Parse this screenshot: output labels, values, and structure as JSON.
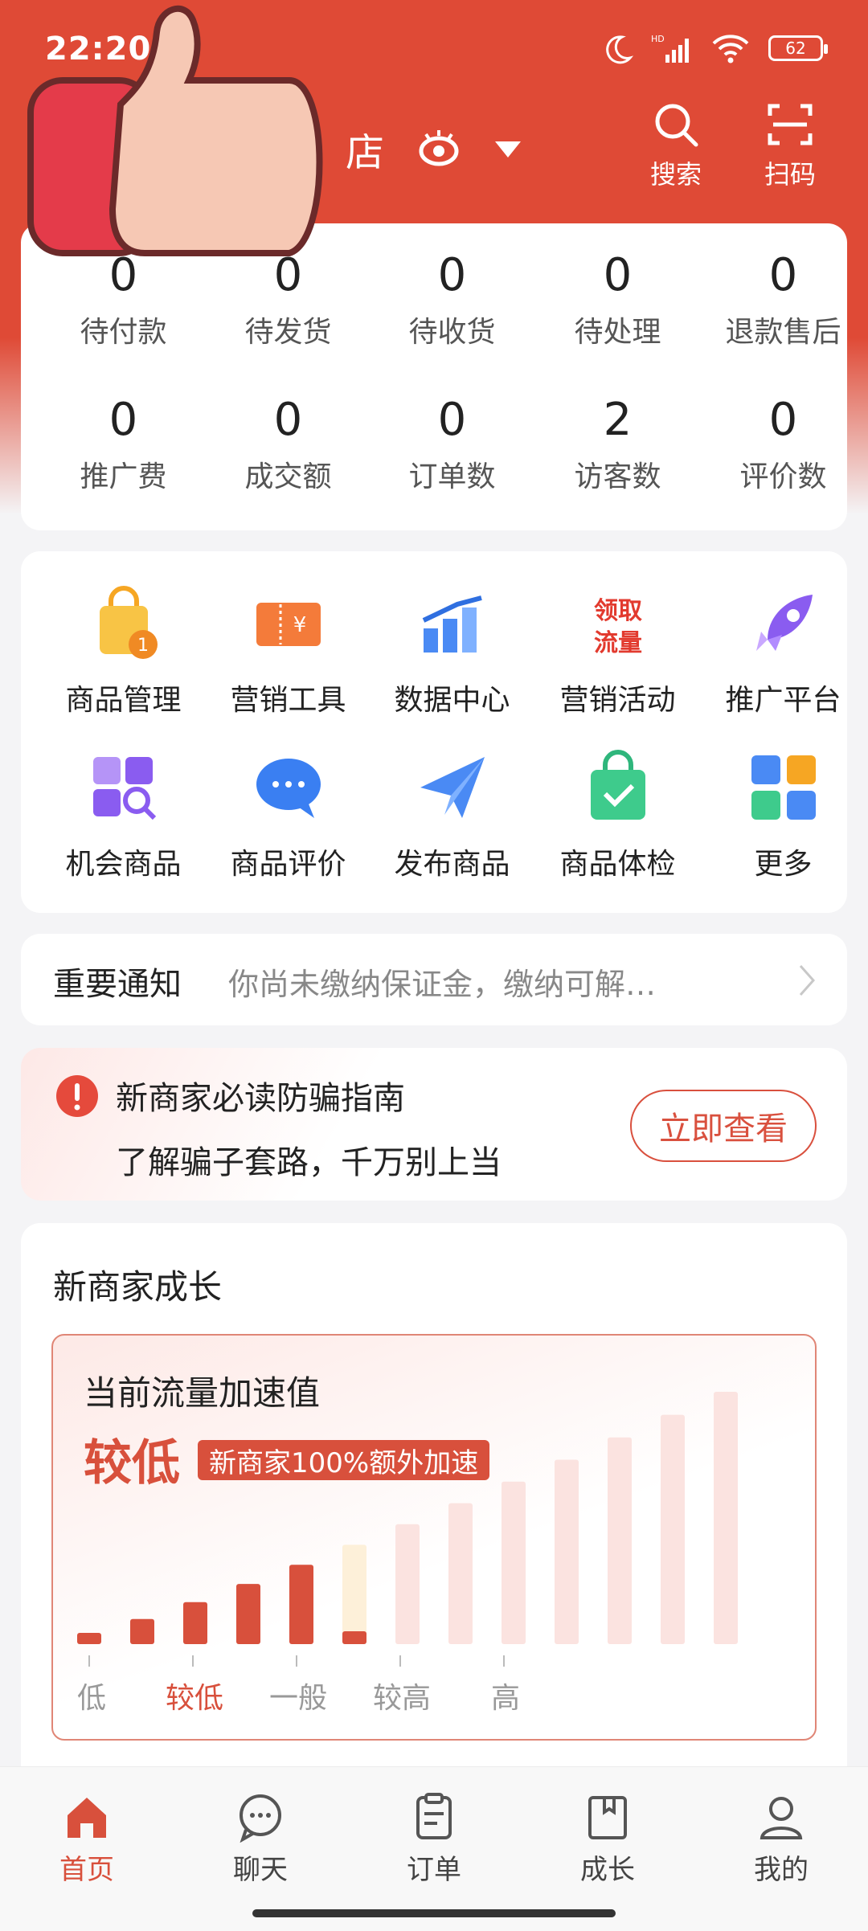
{
  "status_bar": {
    "time": "22:20",
    "battery": "62"
  },
  "header": {
    "store_name": "店",
    "actions": [
      {
        "label": "搜索",
        "icon": "search-icon"
      },
      {
        "label": "扫码",
        "icon": "scan-icon"
      }
    ]
  },
  "stats": {
    "row1": [
      {
        "value": "0",
        "label": "待付款"
      },
      {
        "value": "0",
        "label": "待发货"
      },
      {
        "value": "0",
        "label": "待收货"
      },
      {
        "value": "0",
        "label": "待处理"
      },
      {
        "value": "0",
        "label": "退款售后"
      }
    ],
    "row2": [
      {
        "value": "0",
        "label": "推广费"
      },
      {
        "value": "0",
        "label": "成交额"
      },
      {
        "value": "0",
        "label": "订单数"
      },
      {
        "value": "2",
        "label": "访客数"
      },
      {
        "value": "0",
        "label": "评价数"
      }
    ]
  },
  "tools": [
    {
      "label": "商品管理",
      "icon": "shopping-bag-icon"
    },
    {
      "label": "营销工具",
      "icon": "coupon-icon"
    },
    {
      "label": "数据中心",
      "icon": "bar-chart-icon"
    },
    {
      "label": "营销活动",
      "icon": "traffic-icon",
      "icon_text": [
        "领取",
        "流量"
      ]
    },
    {
      "label": "推广平台",
      "icon": "rocket-icon"
    },
    {
      "label": "机会商品",
      "icon": "grid-search-icon"
    },
    {
      "label": "商品评价",
      "icon": "chat-bubble-icon"
    },
    {
      "label": "发布商品",
      "icon": "paper-plane-icon"
    },
    {
      "label": "商品体检",
      "icon": "check-bag-icon"
    },
    {
      "label": "更多",
      "icon": "more-apps-icon"
    }
  ],
  "notice": {
    "title": "重要通知",
    "text": "你尚未缴纳保证金，缴纳可解…"
  },
  "guide": {
    "title": "新商家必读防骗指南",
    "subtitle": "了解骗子套路，千万别上当",
    "button": "立即查看"
  },
  "growth": {
    "title": "新商家成长",
    "box_title": "当前流量加速值",
    "level": "较低",
    "badge": "新商家100%额外加速",
    "scale_labels": [
      "低",
      "较低",
      "一般",
      "较高",
      "高"
    ],
    "active_level_index": 1,
    "bar_count": 13,
    "filled_bars": 5,
    "partial_bar_index": 5,
    "colors": {
      "filled": "#d8503c",
      "empty": "#fbe3e0",
      "partial_top": "#fdf0d9"
    }
  },
  "bottom_nav": [
    {
      "label": "首页",
      "icon": "home-icon",
      "active": true
    },
    {
      "label": "聊天",
      "icon": "chat-icon",
      "active": false
    },
    {
      "label": "订单",
      "icon": "order-icon",
      "active": false
    },
    {
      "label": "成长",
      "icon": "growth-book-icon",
      "active": false
    },
    {
      "label": "我的",
      "icon": "profile-icon",
      "active": false
    }
  ],
  "colors": {
    "brand": "#df4a36",
    "accent": "#d8503c"
  }
}
